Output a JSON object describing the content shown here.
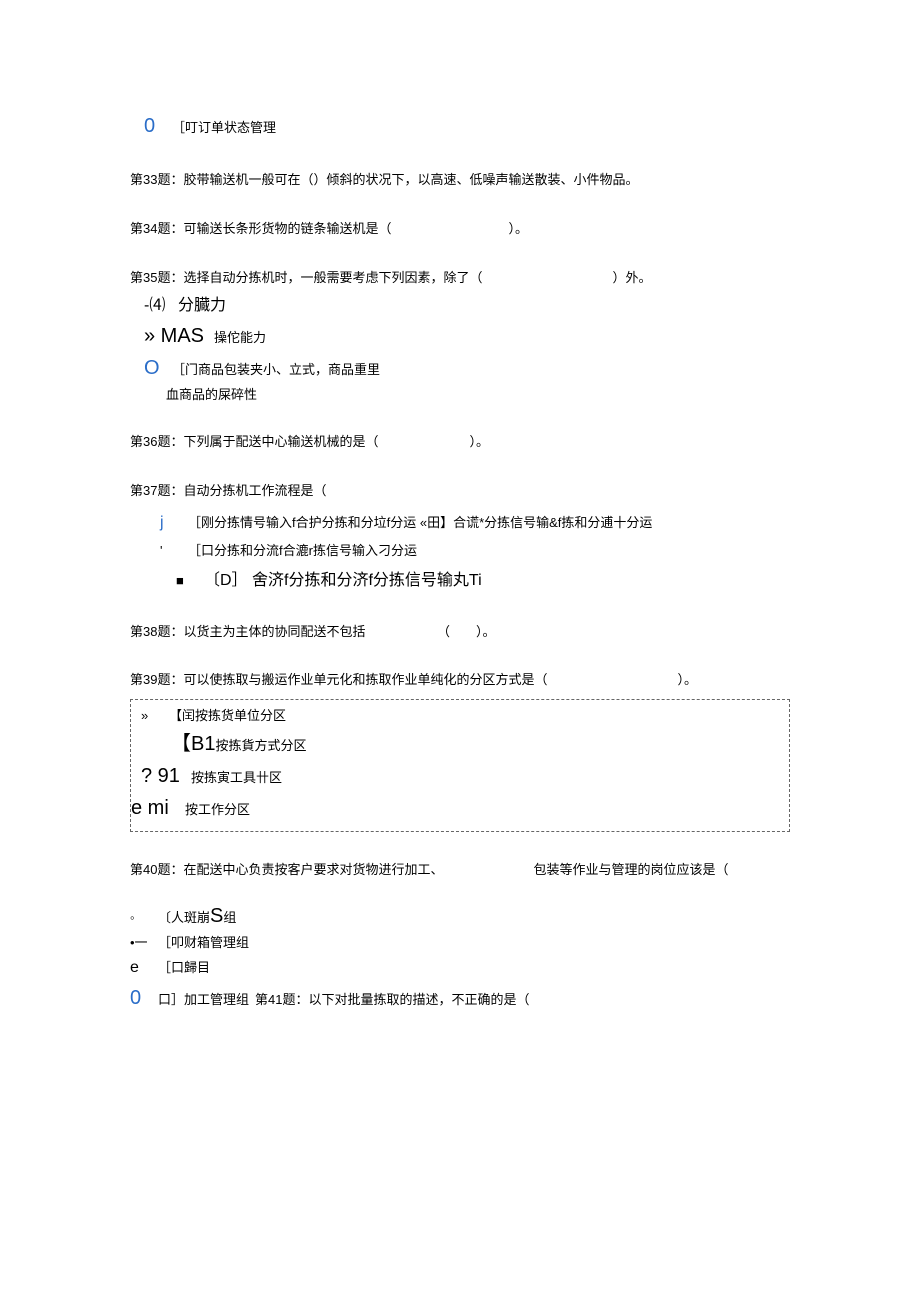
{
  "pre": {
    "marker": "0",
    "text": "［叮订单状态管理"
  },
  "q33": "第33题：胶带输送机一般可在（）倾斜的状况下，以高速、低噪声输送散装、小件物品。",
  "q34": "第34题：可输送长条形货物的链条输送机是（　　　　　　　　　）。",
  "q35": {
    "stem": "第35题：选择自动分拣机时，一般需要考虑下列因素，除了（　　　　　　　　　　）外。",
    "a_marker": "-⑷",
    "a_text": "分臓力",
    "b_marker": "» MAS",
    "b_text": "操佗能力",
    "c_marker": "O",
    "c_text": "［门商品包装夹小、立式，商品重里",
    "d_text": "血商品的屎碎性"
  },
  "q36": "第36题：下列属于配送中心输送机械的是（　　　　　　　）。",
  "q37": {
    "stem": "第37题：自动分拣机工作流程是（",
    "a_marker": "j",
    "a_text": "［刚分拣情号输入f合护分拣和分垃f分运 «田】合谎*分拣信号输&f拣和分逋十分运",
    "b_marker": "'",
    "b_text": "［口分拣和分流f合漉r拣信号输入刁分运",
    "c_marker": "■",
    "c_text": "〔D］ 舍济f分拣和分济f分拣信号输丸Ti"
  },
  "q38": "第38题：以货主为主体的协同配送不包括　　　　　　（　　）。",
  "q39": {
    "stem": "第39题：可以使拣取与搬运作业单元化和拣取作业单纯化的分区方式是（　　　　　　　　　　）。",
    "a_marker": "»",
    "a_text": "【闰按拣货单位分区",
    "b_marker": "【B1",
    "b_text": "按拣貨方式分区",
    "c_marker": "? 91",
    "c_text": "按拣寅工具卄区",
    "d_marker": "e mi",
    "d_text": "按工作分区"
  },
  "q40": {
    "stem_l": "第40题：在配送中心负责按客户要求对货物进行加工、",
    "stem_r": "包装等作业与管理的岗位应该是（",
    "a_marker": "◦",
    "a_text": "〔人斑崩S组",
    "b_marker": "•一",
    "b_text": "［叩财箱管理组",
    "c_marker": "e",
    "c_text": "［口歸目",
    "d_marker": "0",
    "d_text": "口］加工管理组",
    "tail": "第41题：以下对批量拣取的描述，不正确的是（"
  }
}
